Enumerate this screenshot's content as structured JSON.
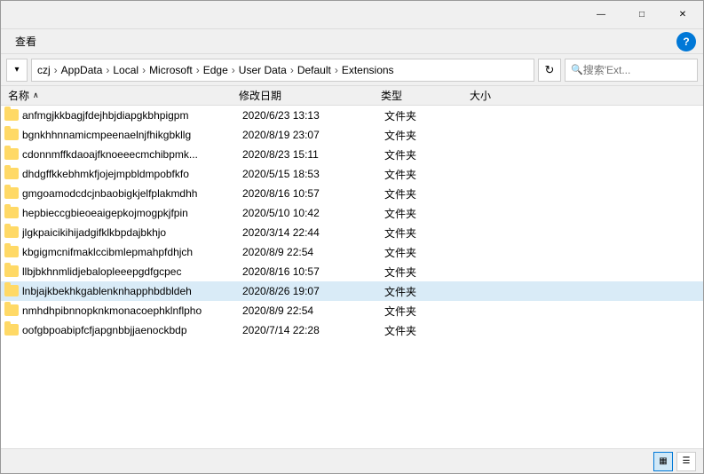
{
  "titlebar": {
    "minimize": "—",
    "maximize": "□",
    "close": "✕"
  },
  "menubar": {
    "view_label": "查看",
    "help_label": "?"
  },
  "addressbar": {
    "breadcrumb": [
      "czj",
      "AppData",
      "Local",
      "Microsoft",
      "Edge",
      "User Data",
      "Default",
      "Extensions"
    ],
    "separators": [
      "›",
      "›",
      "›",
      "›",
      "›",
      "›",
      "›"
    ],
    "dropdown_arrow": "▾",
    "refresh_icon": "↻",
    "search_placeholder": "搜索'Ext..."
  },
  "columns": {
    "name": "名称",
    "date": "修改日期",
    "type": "类型",
    "size": "大小",
    "sort_arrow": "∧"
  },
  "files": [
    {
      "name": "anfmgjkkbagjfdejhbjdiapgkbhpigpm",
      "date": "2020/6/23 13:13",
      "type": "文件夹",
      "size": ""
    },
    {
      "name": "bgnkhhnnamicmpeenaelnjfhikgbkllg",
      "date": "2020/8/19 23:07",
      "type": "文件夹",
      "size": ""
    },
    {
      "name": "cdonnmffkdaoajfknoeeecmchibpmk...",
      "date": "2020/8/23 15:11",
      "type": "文件夹",
      "size": ""
    },
    {
      "name": "dhdgffkkebhmkfjojejmpbldmpobfkfo",
      "date": "2020/5/15 18:53",
      "type": "文件夹",
      "size": ""
    },
    {
      "name": "gmgoamodcdcjnbaobigkjelfplakmdhh",
      "date": "2020/8/16 10:57",
      "type": "文件夹",
      "size": ""
    },
    {
      "name": "hepbieccgbieoeaigepkojmogpkjfpin",
      "date": "2020/5/10 10:42",
      "type": "文件夹",
      "size": ""
    },
    {
      "name": "jlgkpaicikihijadgifklkbpdajbkhjo",
      "date": "2020/3/14 22:44",
      "type": "文件夹",
      "size": ""
    },
    {
      "name": "kbgigmcnifmaklccibmlepmahpfdhjch",
      "date": "2020/8/9 22:54",
      "type": "文件夹",
      "size": ""
    },
    {
      "name": "llbjbkhnmlidjebalopleeepgdfgcpec",
      "date": "2020/8/16 10:57",
      "type": "文件夹",
      "size": ""
    },
    {
      "name": "lnbjajkbekhkgablenknhapphbdbldeh",
      "date": "2020/8/26 19:07",
      "type": "文件夹",
      "size": "",
      "selected": true
    },
    {
      "name": "nmhdhpibnnopknkmonacoephklnflpho",
      "date": "2020/8/9 22:54",
      "type": "文件夹",
      "size": ""
    },
    {
      "name": "oofgbpoabipfcfjapgnbbjjaenockbdp",
      "date": "2020/7/14 22:28",
      "type": "文件夹",
      "size": ""
    }
  ],
  "statusbar": {
    "detail_view_icon": "▦",
    "list_view_icon": "☰"
  }
}
